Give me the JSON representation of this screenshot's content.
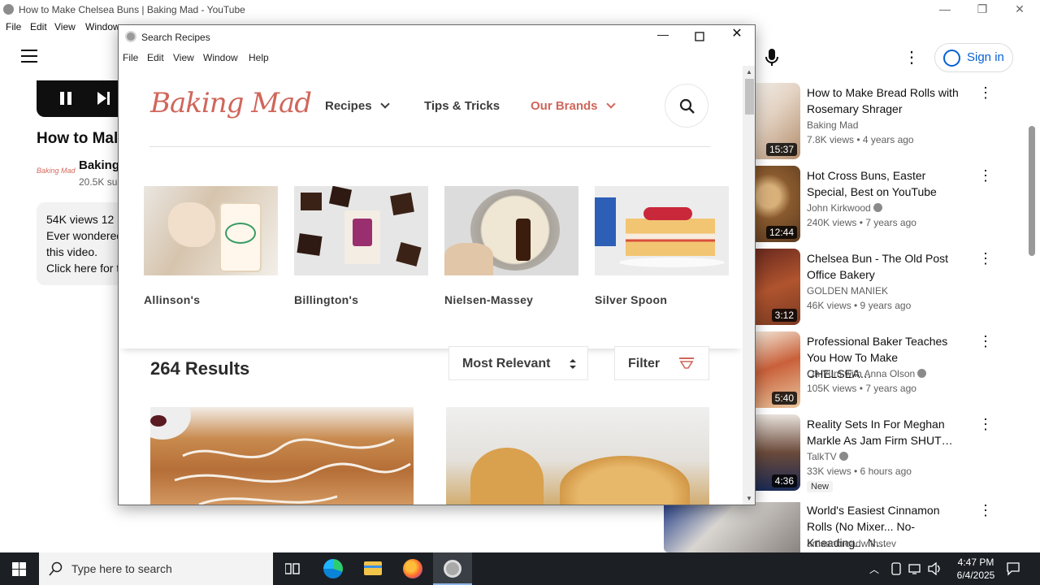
{
  "youtube": {
    "window_title": "How to Make Chelsea Buns | Baking Mad - YouTube",
    "menu": [
      "File",
      "Edit",
      "View",
      "Window"
    ],
    "video_title": "How to Mal",
    "channel_logo_text": "Baking Mad",
    "channel_name": "Baking",
    "channel_subs": "20.5K su",
    "description": {
      "line1": "54K views  12",
      "line2": "Ever wondered",
      "line3": "this video.",
      "line4": "Click here for t"
    },
    "sign_in": "Sign in",
    "recommendations": [
      {
        "title": "How to Make Bread Rolls with Rosemary Shrager",
        "channel": "Baking Mad",
        "meta": "7.8K views  •  4 years ago",
        "duration": "15:37",
        "verified": false,
        "badge": ""
      },
      {
        "title": "Hot Cross Buns, Easter Special, Best on YouTube",
        "channel": "John Kirkwood",
        "meta": "240K views  •  7 years ago",
        "duration": "12:44",
        "verified": true,
        "badge": ""
      },
      {
        "title": "Chelsea Bun - The Old Post Office Bakery",
        "channel": "GOLDEN MANIEK",
        "meta": "46K views  •  9 years ago",
        "duration": "3:12",
        "verified": false,
        "badge": ""
      },
      {
        "title": "Professional Baker Teaches You How To Make CHELSEA…",
        "channel": "Oh Yum with Anna Olson",
        "meta": "105K views  •  7 years ago",
        "duration": "5:40",
        "verified": true,
        "badge": ""
      },
      {
        "title": "Reality Sets In For Meghan Markle As Jam Firm SHUT…",
        "channel": "TalkTV",
        "meta": "33K views  •  6 hours ago",
        "duration": "4:36",
        "verified": true,
        "badge": "New"
      },
      {
        "title": "World's Easiest Cinnamon Rolls (No Mixer... No-Kneading... N…",
        "channel": "artisanbreadwithstev",
        "meta": "",
        "duration": "",
        "verified": false,
        "badge": ""
      }
    ]
  },
  "recipes_window": {
    "title": "Search Recipes",
    "menu": [
      "File",
      "Edit",
      "View",
      "Window",
      "Help"
    ],
    "logo": "Baking Mad",
    "nav": {
      "recipes": "Recipes",
      "tips": "Tips & Tricks",
      "brands": "Our Brands"
    },
    "brands": [
      {
        "name": "Allinson's",
        "icon": "flour-dough-photo"
      },
      {
        "name": "Billington's",
        "icon": "brownies-photo"
      },
      {
        "name": "Nielsen-Massey",
        "icon": "vanilla-bowl-photo"
      },
      {
        "name": "Silver Spoon",
        "icon": "layer-cake-photo"
      }
    ],
    "results_count": "264 Results",
    "sort": "Most Relevant",
    "filter": "Filter"
  },
  "taskbar": {
    "search_placeholder": "Type here to search",
    "time": "4:47 PM",
    "date": "6/4/2025"
  },
  "colors": {
    "brand_accent": "#d0665b",
    "youtube_link": "#065fd4",
    "taskbar": "#1c1f24"
  }
}
